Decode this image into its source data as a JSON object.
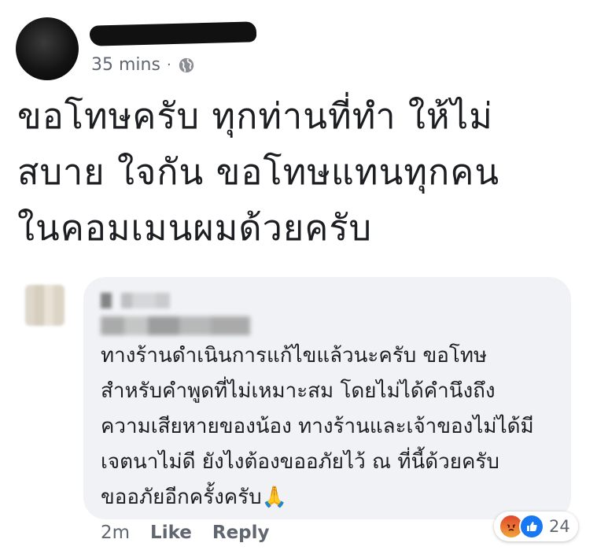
{
  "post": {
    "time": "35 mins",
    "separator": "·",
    "text": "ขอโทษครับ ทุกท่านที่ทำ ให้ไม่\nสบาย ใจกัน ขอโทษแทนทุกคน\nในคอมเมนผมด้วยครับ"
  },
  "comment": {
    "text": "ทางร้านดำเนินการแก้ไขแล้วนะครับ ขอโทษ\nสำหรับคำพูดที่ไม่เหมาะสม โดยไม่ได้คำนึงถึง\nความเสียหายของน้อง ทางร้านและเจ้าของไม่ได้มี\nเจตนาไม่ดี ยังไงต้องขออภัยไว้ ณ ที่นี้ด้วยครับ\nขออภัยอีกครั้งครับ",
    "emoji": "🙏",
    "time": "2m",
    "like_label": "Like",
    "reply_label": "Reply",
    "reaction_count": "24",
    "reactions": [
      "angry-icon",
      "like-icon"
    ]
  },
  "colors": {
    "bubble": "#f0f2f5",
    "like_blue": "#1877f2",
    "meta_gray": "#606770"
  }
}
